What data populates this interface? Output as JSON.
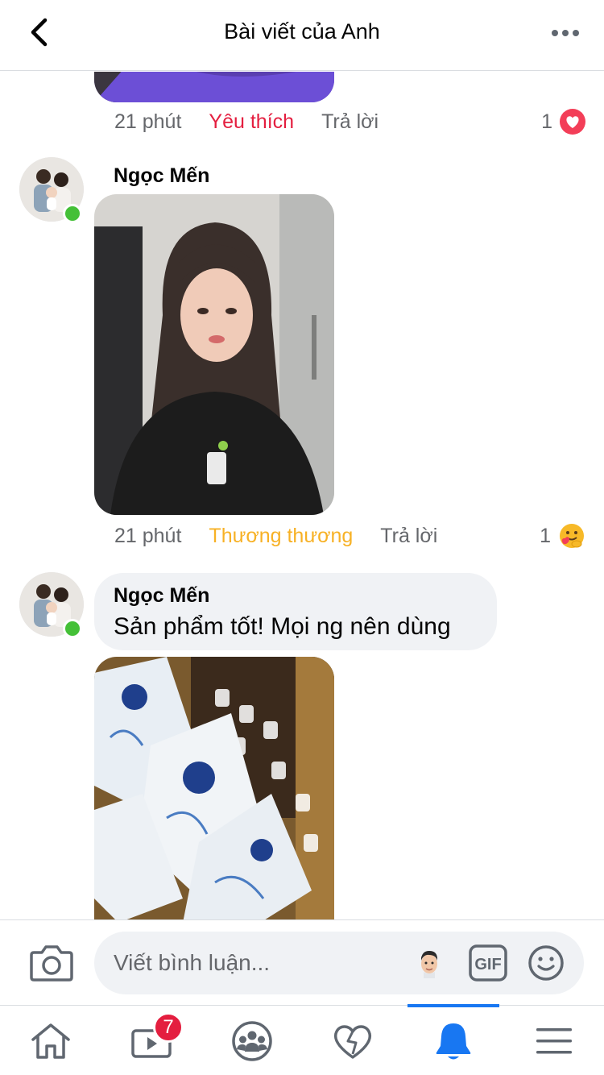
{
  "header": {
    "title": "Bài viết của Anh"
  },
  "comments": [
    {
      "time": "21 phút",
      "reaction_label": "Yêu thích",
      "reaction_color": "#e41e3f",
      "reply_label": "Trả lời",
      "reaction_count": "1",
      "reaction_icon": "love-heart-icon"
    },
    {
      "author": "Ngọc Mến",
      "time": "21 phút",
      "reaction_label": "Thương thương",
      "reaction_color": "#f7b125",
      "reply_label": "Trả lời",
      "reaction_count": "1",
      "reaction_icon": "care-hug-icon"
    },
    {
      "author": "Ngọc Mến",
      "text": "Sản phẩm tốt! Mọi ng nên dùng"
    }
  ],
  "composer": {
    "placeholder": "Viết bình luận...",
    "gif_label": "GIF"
  },
  "tabbar": {
    "items": [
      "home-icon",
      "watch-icon",
      "groups-icon",
      "dating-icon",
      "notifications-icon",
      "menu-icon"
    ],
    "active": "notifications-icon",
    "watch_badge": "7"
  },
  "colors": {
    "accent": "#1877f2",
    "online": "#44c037",
    "badge": "#e41e3f"
  }
}
